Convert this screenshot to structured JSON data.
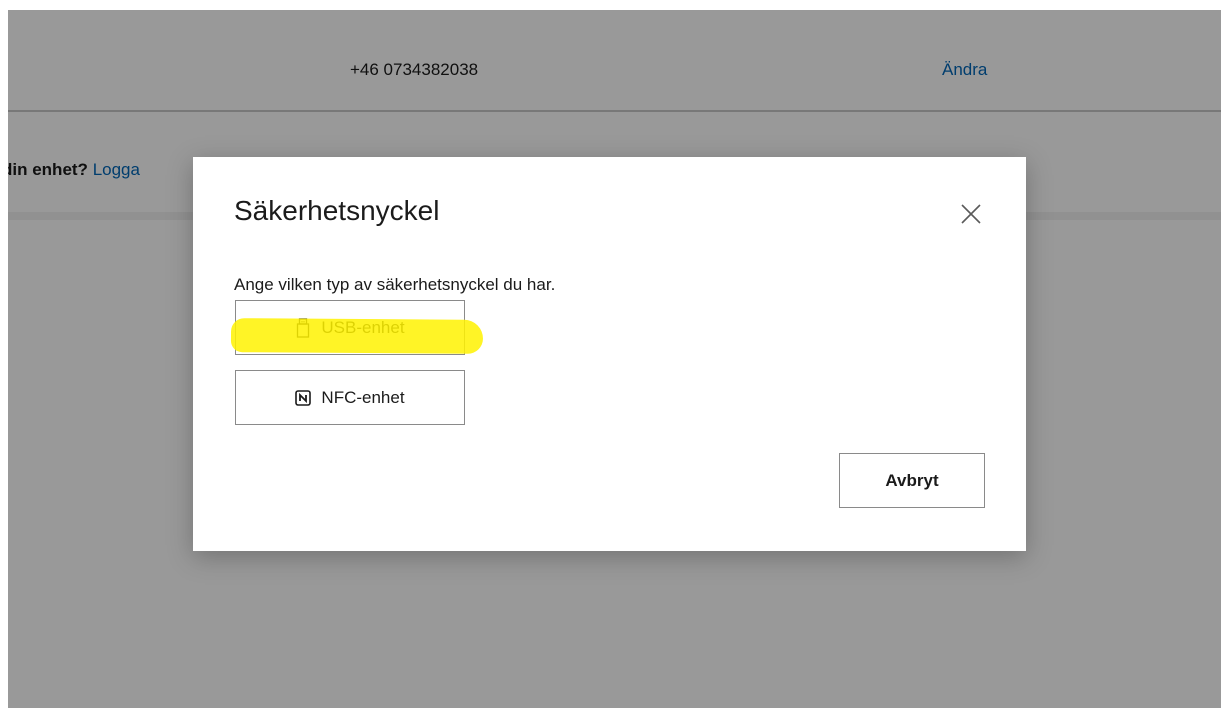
{
  "background": {
    "phone_number": "+46 0734382038",
    "change_link": "Ändra",
    "device_question_text": "din enhet?",
    "device_question_link": "Logga"
  },
  "dialog": {
    "title": "Säkerhetsnyckel",
    "close_icon": "close-icon",
    "description": "Ange vilken typ av säkerhetsnyckel du har.",
    "options": [
      {
        "label": "USB-enhet",
        "icon": "usb-drive-icon",
        "highlighted": true
      },
      {
        "label": "NFC-enhet",
        "icon": "nfc-icon",
        "highlighted": false
      }
    ],
    "cancel_label": "Avbryt"
  },
  "colors": {
    "link": "#0067b8",
    "highlight": "#fff200",
    "overlay": "rgba(0,0,0,0.4)"
  }
}
